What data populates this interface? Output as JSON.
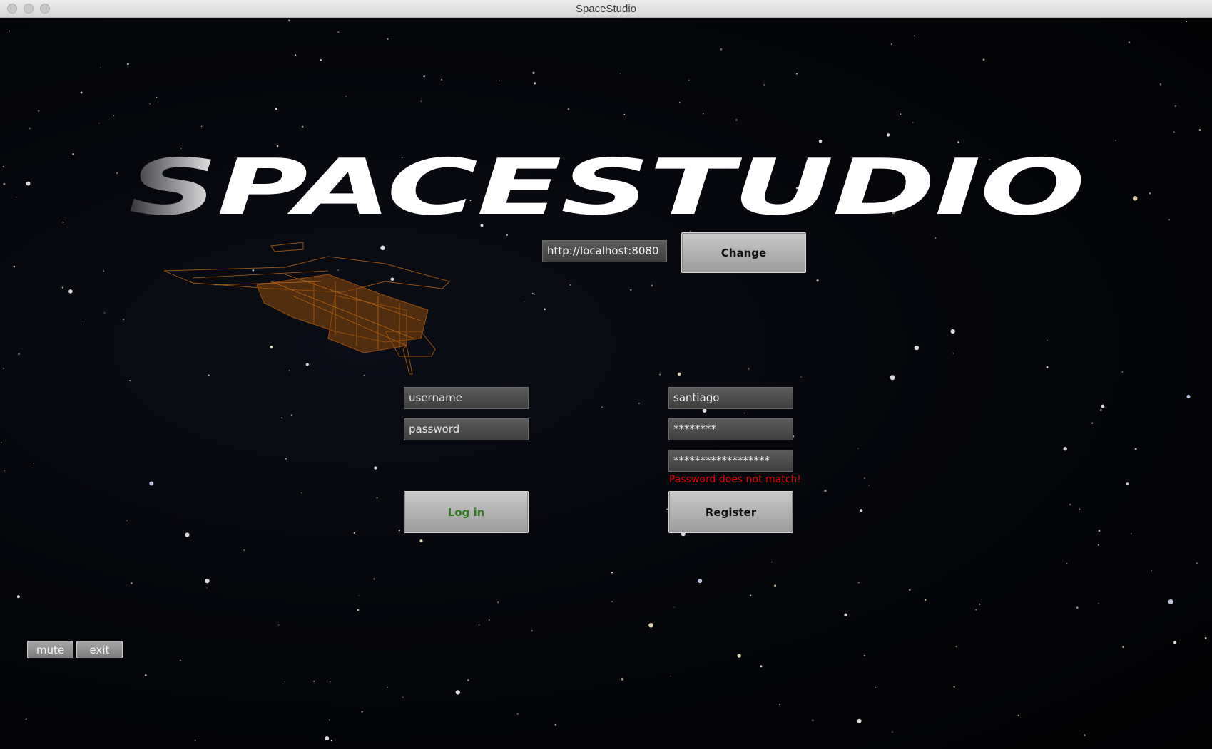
{
  "window": {
    "title": "SpaceStudio"
  },
  "logo": {
    "text": "SPACESTUDIO"
  },
  "server": {
    "url": "http://localhost:8080",
    "change_label": "Change"
  },
  "login": {
    "username_placeholder": "username",
    "password_placeholder": "password",
    "login_label": "Log in"
  },
  "register": {
    "username_value": "santiago",
    "password_value": "********",
    "confirm_value": "******************",
    "error": "Password does not match!",
    "register_label": "Register"
  },
  "controls": {
    "mute_label": "mute",
    "exit_label": "exit"
  },
  "colors": {
    "background": "#020203",
    "logo": "#ffffff",
    "ship": "#c06a12",
    "login_text": "#2f7a1c",
    "error": "#e00000"
  }
}
